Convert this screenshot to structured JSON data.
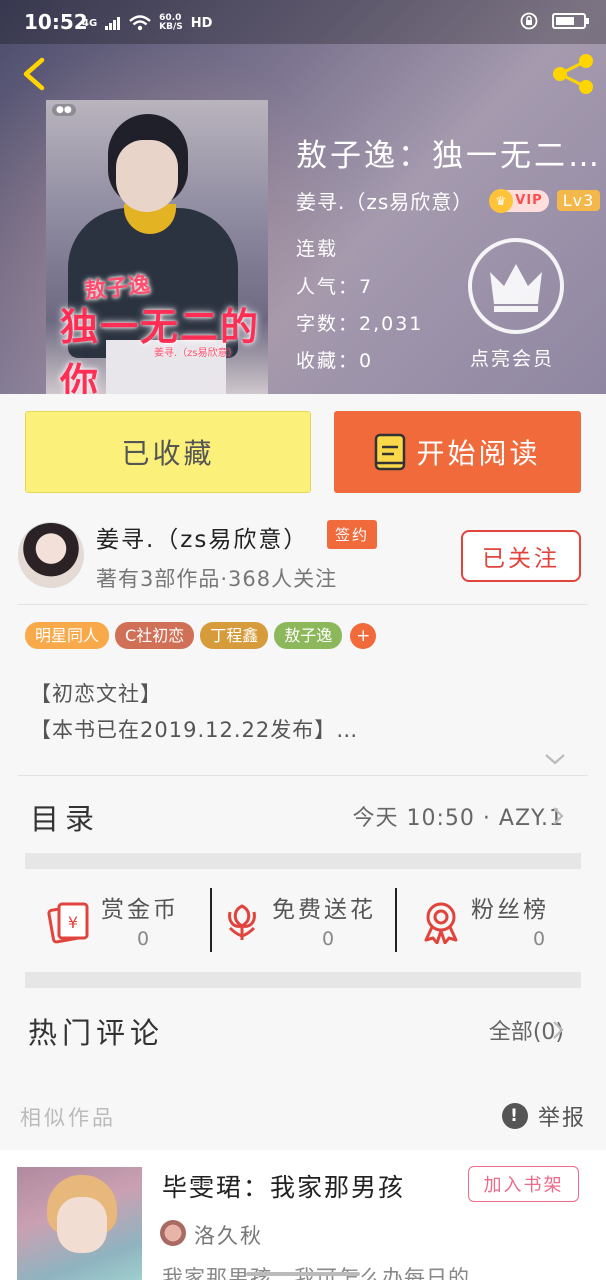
{
  "status_bar": {
    "time": "10:52",
    "network": "4G",
    "speed": "60.0",
    "speed_unit": "KB/S",
    "hd": "HD"
  },
  "book": {
    "title": "敖子逸：独一无二…",
    "author": "姜寻.（zs易欣意）",
    "vip": "VIP",
    "level": "Lv3",
    "status": "连载",
    "popularity": "人气：7",
    "word_count": "字数：2,031",
    "favorites": "收藏：0",
    "member_label": "点亮会员",
    "cover": {
      "t1": "敖子逸",
      "t2": "独一无二的你",
      "t3": "姜寻.（zs易欣意）"
    }
  },
  "actions": {
    "collect": "已收藏",
    "read": "开始阅读"
  },
  "author_info": {
    "name": "姜寻.（zs易欣意）",
    "badge": "签约",
    "meta": "著有3部作品·368人关注",
    "follow": "已关注"
  },
  "tags": [
    {
      "label": "明星同人",
      "color": "#f8a94a"
    },
    {
      "label": "C社初恋",
      "color": "#d07057"
    },
    {
      "label": "丁程鑫",
      "color": "#d69b3b"
    },
    {
      "label": "敖子逸",
      "color": "#8cb75a"
    }
  ],
  "tag_add": "+",
  "intro": [
    "【初恋文社】",
    "【本书已在2019.12.22发布】…"
  ],
  "toc": {
    "label": "目录",
    "value": "今天 10:50 · AZY.1"
  },
  "rewards": [
    {
      "label": "赏金币",
      "count": "0"
    },
    {
      "label": "免费送花",
      "count": "0"
    },
    {
      "label": "粉丝榜",
      "count": "0"
    }
  ],
  "hot_comments": {
    "label": "热门评论",
    "all": "全部(0)"
  },
  "similar": {
    "label": "相似作品",
    "report": "举报",
    "item": {
      "title": "毕雯珺：我家那男孩",
      "shelf": "加入书架",
      "author": "洛久秋",
      "desc": "我家那男孩，我可怎么办每日的…"
    }
  },
  "colors": {
    "accent": "#f06a3c",
    "collect_bg": "#fbf07a",
    "follow": "#e0443c",
    "reward_red": "#e0443c"
  }
}
